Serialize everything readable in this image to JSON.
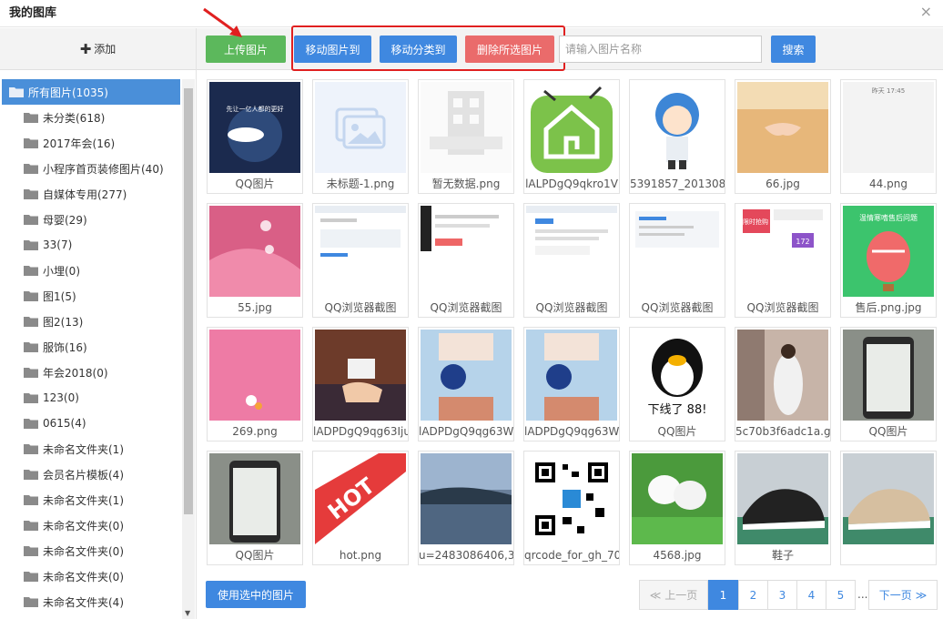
{
  "title": "我的图库",
  "close_icon": "×",
  "sidebar": {
    "add_label": "添加",
    "items": [
      {
        "label": "所有图片(1035)"
      },
      {
        "label": "未分类(618)"
      },
      {
        "label": "2017年会(16)"
      },
      {
        "label": "小程序首页装修图片(40)"
      },
      {
        "label": "自媒体专用(277)"
      },
      {
        "label": "母婴(29)"
      },
      {
        "label": "33(7)"
      },
      {
        "label": "小埋(0)"
      },
      {
        "label": "图1(5)"
      },
      {
        "label": "图2(13)"
      },
      {
        "label": "服饰(16)"
      },
      {
        "label": "年会2018(0)"
      },
      {
        "label": "123(0)"
      },
      {
        "label": "0615(4)"
      },
      {
        "label": "未命名文件夹(1)"
      },
      {
        "label": "会员名片模板(4)"
      },
      {
        "label": "未命名文件夹(1)"
      },
      {
        "label": "未命名文件夹(0)"
      },
      {
        "label": "未命名文件夹(0)"
      },
      {
        "label": "未命名文件夹(0)"
      },
      {
        "label": "未命名文件夹(4)"
      }
    ]
  },
  "toolbar": {
    "upload_label": "上传图片",
    "move_image_label": "移动图片到",
    "move_category_label": "移动分类到",
    "delete_label": "删除所选图片",
    "search_placeholder": "请输入图片名称",
    "search_label": "搜索"
  },
  "images": [
    {
      "name": "QQ图片"
    },
    {
      "name": "未标题-1.png"
    },
    {
      "name": "暂无数据.png"
    },
    {
      "name": "lALPDgQ9qkro1V"
    },
    {
      "name": "5391857_2013080"
    },
    {
      "name": "66.jpg"
    },
    {
      "name": "44.png"
    },
    {
      "name": "55.jpg"
    },
    {
      "name": "QQ浏览器截图"
    },
    {
      "name": "QQ浏览器截图"
    },
    {
      "name": "QQ浏览器截图"
    },
    {
      "name": "QQ浏览器截图"
    },
    {
      "name": "QQ浏览器截图"
    },
    {
      "name": "售后.png.jpg"
    },
    {
      "name": "269.png"
    },
    {
      "name": "lADPDgQ9qg63Iju"
    },
    {
      "name": "lADPDgQ9qg63W"
    },
    {
      "name": "lADPDgQ9qg63W"
    },
    {
      "name": "QQ图片"
    },
    {
      "name": "5c70b3f6adc1a.gi"
    },
    {
      "name": "QQ图片"
    },
    {
      "name": "QQ图片"
    },
    {
      "name": "hot.png"
    },
    {
      "name": "u=2483086406,30"
    },
    {
      "name": "qrcode_for_gh_70"
    },
    {
      "name": "4568.jpg"
    },
    {
      "name": "鞋子"
    },
    {
      "name": ""
    }
  ],
  "thumb_texts": {
    "poster_text": "先让一亿人都的更好",
    "chat_time": "昨天 17:45",
    "qq_text": "下线了 88!",
    "hot_text": "HOT",
    "balloon_text": "温情寒嗜售后问题",
    "promo_text": "限时抢购",
    "promo_num": "172"
  },
  "footer": {
    "use_selected_label": "使用选中的图片",
    "prev_label": "上一页",
    "next_label": "下一页",
    "pages": [
      "1",
      "2",
      "3",
      "4",
      "5"
    ],
    "ellipsis": "...",
    "current_page": "1"
  },
  "colors": {
    "primary": "#3f88e0",
    "success": "#5cb85c",
    "danger": "#ea6b6b",
    "annotation": "#e02020"
  }
}
